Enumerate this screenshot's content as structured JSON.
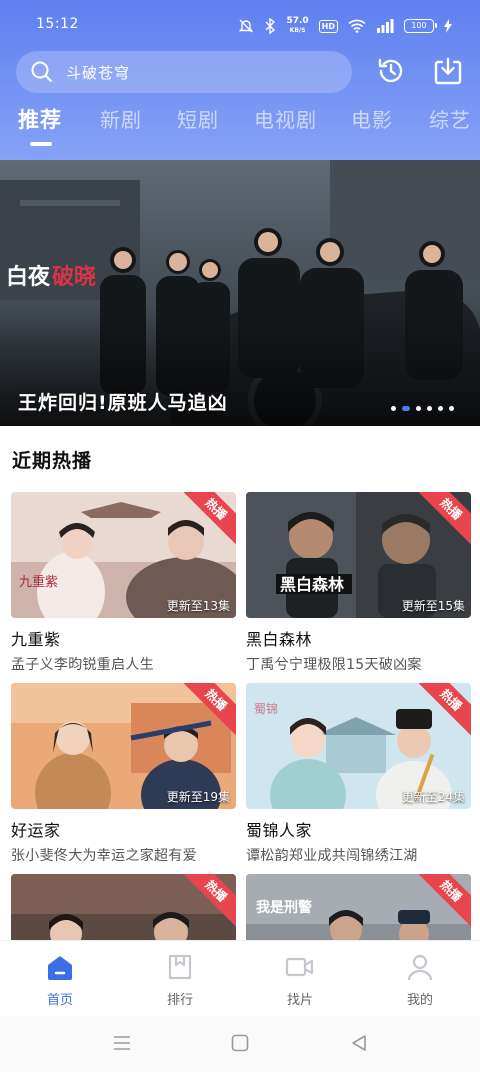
{
  "status": {
    "time": "15:12",
    "speed_value": "57.0",
    "speed_unit": "KB/S",
    "hd": "HD",
    "battery": "100"
  },
  "search": {
    "placeholder": "斗破苍穹"
  },
  "tabs": [
    {
      "label": "推荐",
      "active": true
    },
    {
      "label": "新剧"
    },
    {
      "label": "短剧"
    },
    {
      "label": "电视剧"
    },
    {
      "label": "电影"
    },
    {
      "label": "综艺"
    }
  ],
  "banner": {
    "caption": "王炸回归!原班人马追凶",
    "logo_text": "白夜破晓",
    "slides": 6,
    "active_slide": 1
  },
  "section": {
    "title": "近期热播"
  },
  "cards": [
    {
      "name": "九重紫",
      "desc": "孟子义李昀锐重启人生",
      "episode": "更新至13集",
      "badge": "热播"
    },
    {
      "name": "黑白森林",
      "desc": "丁禹兮宁理极限15天破凶案",
      "episode": "更新至15集",
      "badge": "热播"
    },
    {
      "name": "好运家",
      "desc": "张小斐佟大为幸运之家超有爱",
      "episode": "更新至19集",
      "badge": "热播"
    },
    {
      "name": "蜀锦人家",
      "desc": "谭松韵郑业成共闯锦绣江湖",
      "episode": "更新至24集",
      "badge": "热播"
    },
    {
      "name": "",
      "desc": "",
      "episode": "",
      "badge": "热播"
    },
    {
      "name": "",
      "desc": "",
      "episode": "",
      "badge": "热播"
    }
  ],
  "bottom_nav": [
    {
      "label": "首页",
      "icon": "home-icon",
      "active": true
    },
    {
      "label": "排行",
      "icon": "ranking-icon"
    },
    {
      "label": "找片",
      "icon": "video-camera-icon"
    },
    {
      "label": "我的",
      "icon": "person-icon"
    }
  ],
  "colors": {
    "accent": "#3b6fe5",
    "header_top": "#5f7ff0",
    "hot_badge": "#e8454f"
  }
}
